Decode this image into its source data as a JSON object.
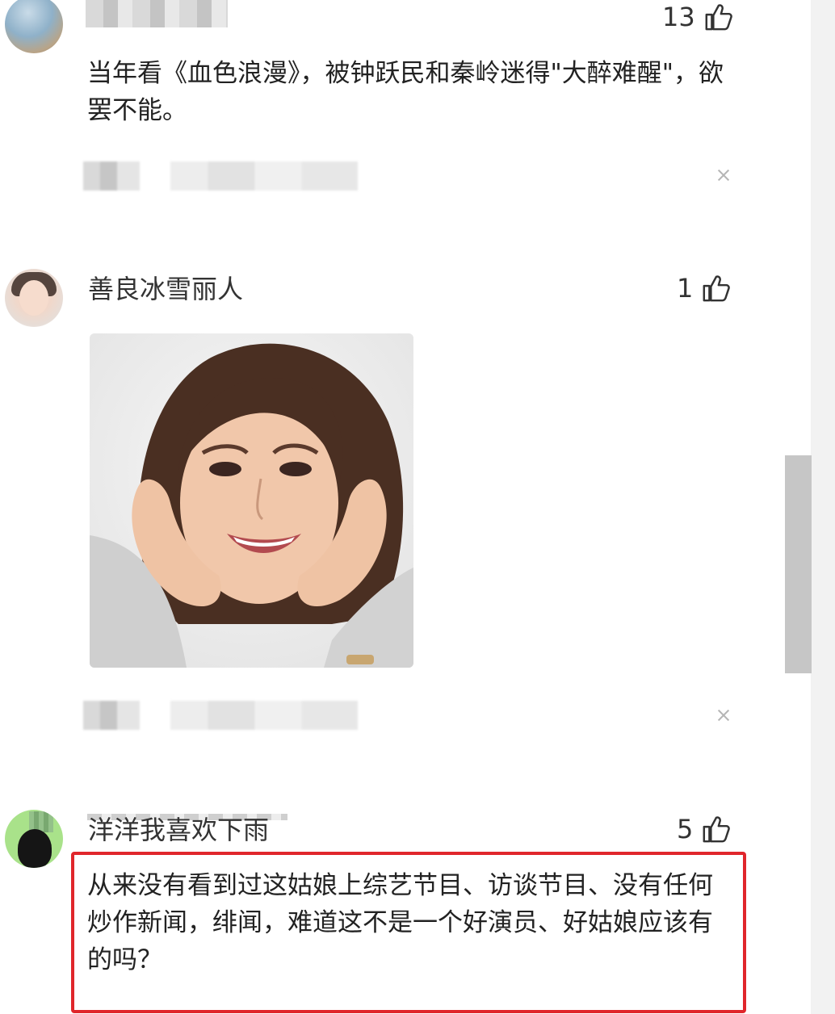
{
  "comments": [
    {
      "likes": "13",
      "text": "当年看《血色浪漫》，被钟跃民和秦岭迷得\"大醉难醒\"，欲罢不能。"
    },
    {
      "username": "善良冰雪丽人",
      "likes": "1"
    },
    {
      "username": "洋洋我喜欢下雨",
      "likes": "5",
      "text": "从来没有看到过这姑娘上综艺节目、访谈节目、没有任何炒作新闻，绯闻，难道这不是一个好演员、好姑娘应该有的吗？"
    }
  ],
  "icons": {
    "like": "thumbs-up-icon",
    "close": "close-icon"
  },
  "colors": {
    "highlight": "#e0262b",
    "text": "#222222",
    "scrollbar_thumb": "#c6c6c6"
  }
}
